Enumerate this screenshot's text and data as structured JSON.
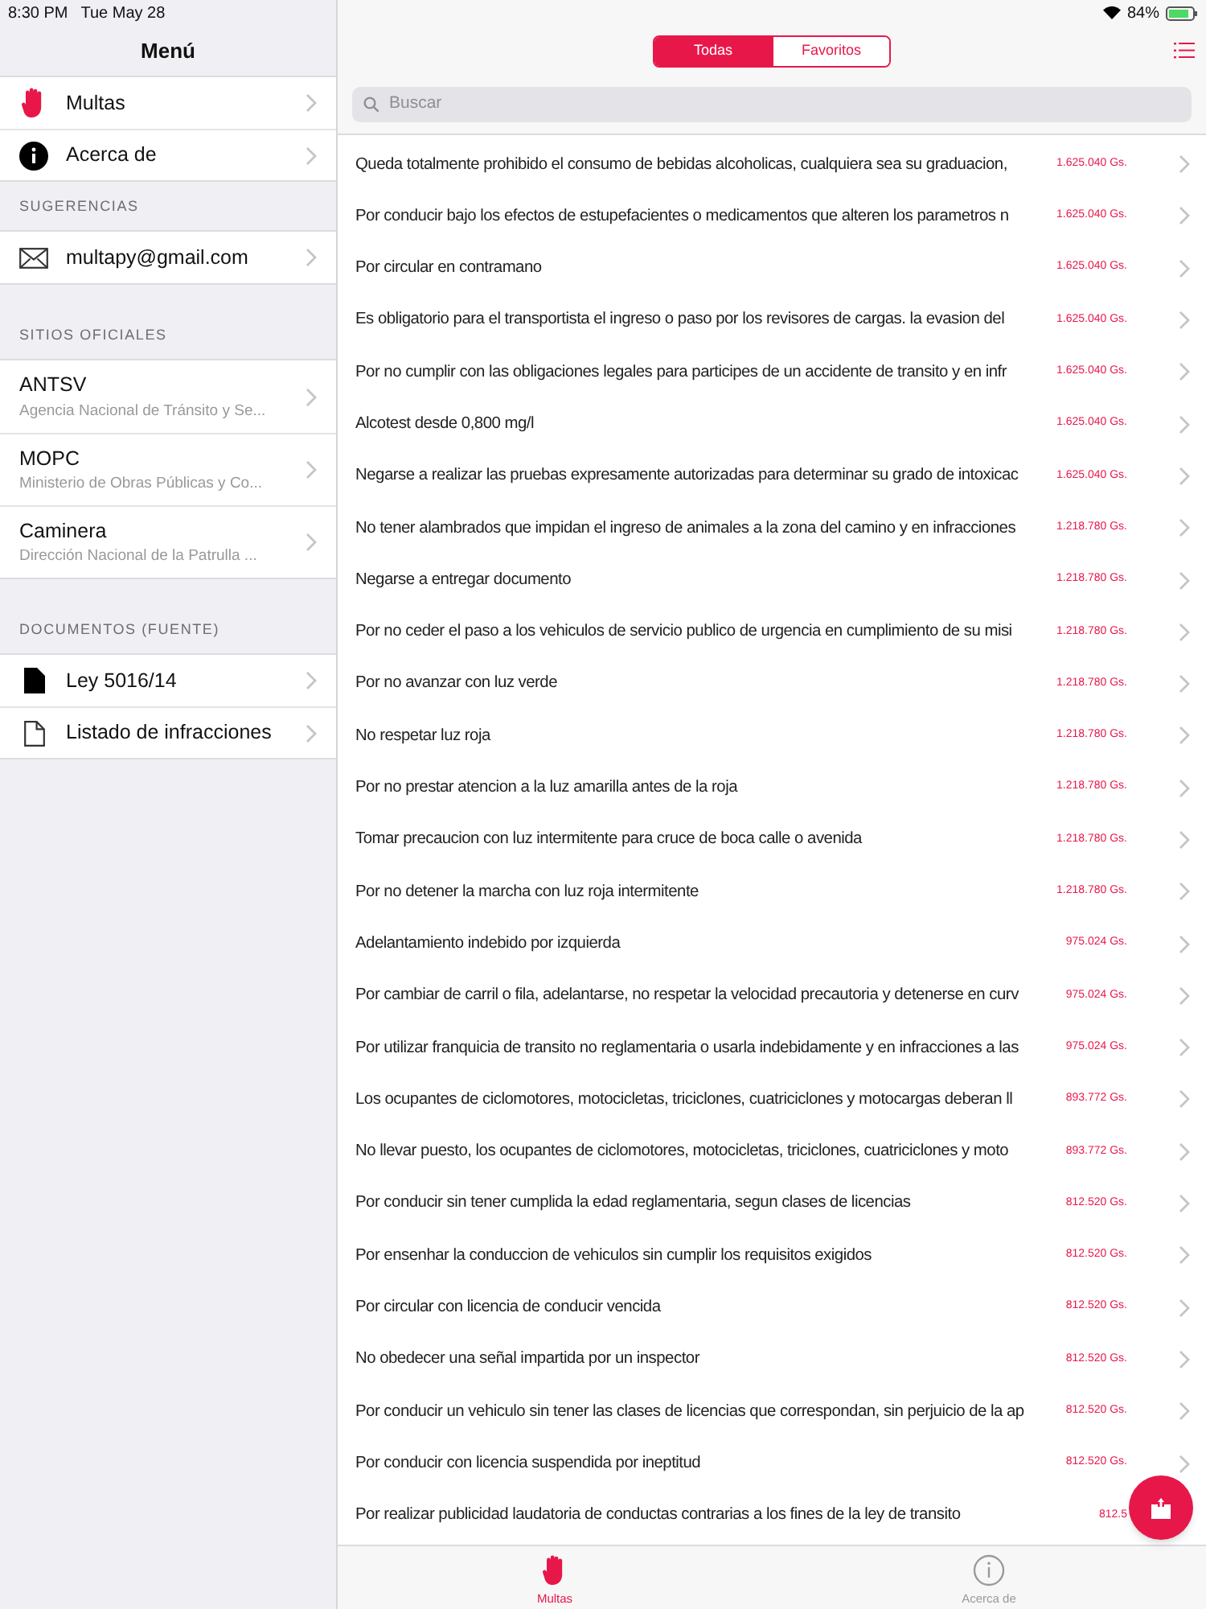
{
  "status_bar": {
    "time": "8:30 PM",
    "date": "Tue May 28",
    "battery": "84%"
  },
  "sidebar": {
    "title": "Menú",
    "sections": [
      {
        "items": [
          {
            "kind": "hand",
            "label": "Multas"
          },
          {
            "kind": "info",
            "label": "Acerca de"
          }
        ]
      },
      {
        "header": "SUGERENCIAS",
        "items": [
          {
            "kind": "mail",
            "label": "multapy@gmail.com"
          }
        ]
      },
      {
        "header": "SITIOS OFICIALES",
        "items": [
          {
            "label": "ANTSV",
            "subtitle": "Agencia Nacional de Tránsito y Se..."
          },
          {
            "label": "MOPC",
            "subtitle": "Ministerio de Obras Públicas y Co..."
          },
          {
            "label": "Caminera",
            "subtitle": "Dirección Nacional de la Patrulla ..."
          }
        ]
      },
      {
        "header": "DOCUMENTOS (FUENTE)",
        "items": [
          {
            "kind": "file-filled",
            "label": "Ley 5016/14"
          },
          {
            "kind": "file-outline",
            "label": "Listado de infracciones"
          }
        ]
      }
    ]
  },
  "segments": [
    {
      "label": "Todas",
      "selected": true
    },
    {
      "label": "Favoritos",
      "selected": false
    }
  ],
  "search": {
    "placeholder": "Buscar"
  },
  "fines": [
    {
      "text": "Queda totalmente prohibido el consumo de bebidas alcoholicas, cualquiera sea su graduacion,",
      "amount": "1.625.040 Gs."
    },
    {
      "text": "Por conducir bajo los efectos de estupefacientes o medicamentos que alteren los parametros n",
      "amount": "1.625.040 Gs."
    },
    {
      "text": "Por circular en contramano",
      "amount": "1.625.040 Gs."
    },
    {
      "text": "Es obligatorio para el transportista el ingreso o paso por los revisores de cargas. la evasion del",
      "amount": "1.625.040 Gs."
    },
    {
      "text": "Por no cumplir con las obligaciones legales para participes de un accidente de transito y en infr",
      "amount": "1.625.040 Gs."
    },
    {
      "text": "Alcotest desde 0,800 mg/l",
      "amount": "1.625.040 Gs."
    },
    {
      "text": "Negarse a realizar las pruebas expresamente autorizadas para determinar su grado de intoxicac",
      "amount": "1.625.040 Gs."
    },
    {
      "text": "No tener alambrados que impidan el ingreso de animales a la zona del camino y en infracciones",
      "amount": "1.218.780 Gs."
    },
    {
      "text": "Negarse a entregar documento",
      "amount": "1.218.780 Gs."
    },
    {
      "text": "Por no ceder el paso a los vehiculos de servicio publico de urgencia en cumplimiento de su misi",
      "amount": "1.218.780 Gs."
    },
    {
      "text": "Por no avanzar con luz verde",
      "amount": "1.218.780 Gs."
    },
    {
      "text": "No respetar luz roja",
      "amount": "1.218.780 Gs."
    },
    {
      "text": "Por no prestar atencion a la luz amarilla antes de la roja",
      "amount": "1.218.780 Gs."
    },
    {
      "text": "Tomar precaucion con luz intermitente para cruce de boca calle o avenida",
      "amount": "1.218.780 Gs."
    },
    {
      "text": "Por no detener la marcha con luz roja intermitente",
      "amount": "1.218.780 Gs."
    },
    {
      "text": "Adelantamiento indebido por izquierda",
      "amount": "975.024 Gs."
    },
    {
      "text": "Por cambiar de carril o fila, adelantarse, no respetar la velocidad precautoria y detenerse en curv",
      "amount": "975.024 Gs."
    },
    {
      "text": "Por utilizar franquicia de transito no reglamentaria o usarla indebidamente y en infracciones a las",
      "amount": "975.024 Gs."
    },
    {
      "text": "Los ocupantes de ciclomotores, motocicletas, triciclones, cuatriciclones y motocargas deberan ll",
      "amount": "893.772 Gs."
    },
    {
      "text": "No llevar puesto, los ocupantes de ciclomotores, motocicletas, triciclones, cuatriciclones y moto",
      "amount": "893.772 Gs."
    },
    {
      "text": "Por conducir sin tener cumplida la edad reglamentaria, segun clases de licencias",
      "amount": "812.520 Gs."
    },
    {
      "text": "Por ensenhar la conduccion de vehiculos sin cumplir los requisitos exigidos",
      "amount": "812.520 Gs."
    },
    {
      "text": "Por circular con licencia de conducir vencida",
      "amount": "812.520 Gs."
    },
    {
      "text": "No obedecer una señal impartida por un inspector",
      "amount": "812.520 Gs."
    },
    {
      "text": "Por conducir un vehiculo sin tener las clases de licencias que correspondan, sin perjuicio de la ap",
      "amount": "812.520 Gs."
    },
    {
      "text": "Por conducir con licencia suspendida por ineptitud",
      "amount": "812.520 Gs."
    },
    {
      "text": "Por realizar publicidad laudatoria de conductas contrarias a los fines de la ley de transito",
      "amount": "812.5"
    }
  ],
  "tab_bar": [
    {
      "kind": "hand",
      "label": "Multas",
      "selected": true
    },
    {
      "kind": "info",
      "label": "Acerca de",
      "selected": false
    }
  ]
}
